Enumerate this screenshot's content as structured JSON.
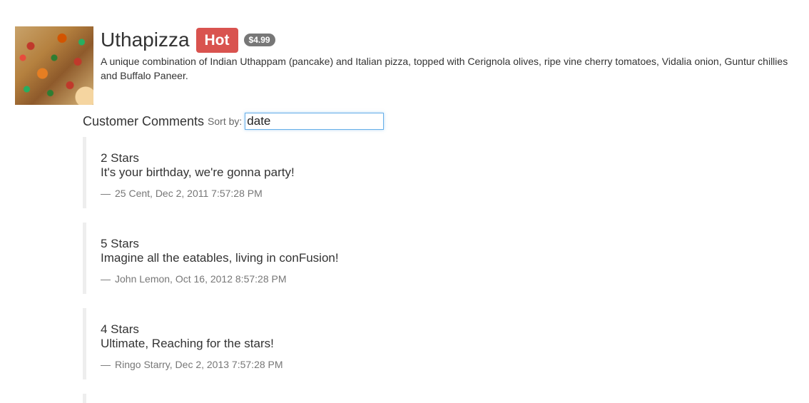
{
  "dish": {
    "name": "Uthapizza",
    "label": "Hot",
    "price": "$4.99",
    "image_alt": "Uthapizza",
    "description": "A unique combination of Indian Uthappam (pancake) and Italian pizza, topped with Cerignola olives, ripe vine cherry tomatoes, Vidalia onion, Guntur chillies and Buffalo Paneer."
  },
  "comments_section": {
    "title": "Customer Comments",
    "sort_label": "Sort by:",
    "sort_value": "date"
  },
  "comments": [
    {
      "rating": "2 Stars",
      "text": "It's your birthday, we're gonna party!",
      "dash": "—",
      "byline": "25 Cent, Dec 2, 2011 7:57:28 PM"
    },
    {
      "rating": "5 Stars",
      "text": "Imagine all the eatables, living in conFusion!",
      "dash": "—",
      "byline": "John Lemon, Oct 16, 2012 8:57:28 PM"
    },
    {
      "rating": "4 Stars",
      "text": "Ultimate, Reaching for the stars!",
      "dash": "—",
      "byline": "Ringo Starry, Dec 2, 2013 7:57:28 PM"
    }
  ],
  "colors": {
    "hot_label": "#d9534f",
    "price_badge": "#777777",
    "input_focus_border": "#66afe9",
    "comment_border": "#eeeeee",
    "muted_text": "#777777"
  }
}
